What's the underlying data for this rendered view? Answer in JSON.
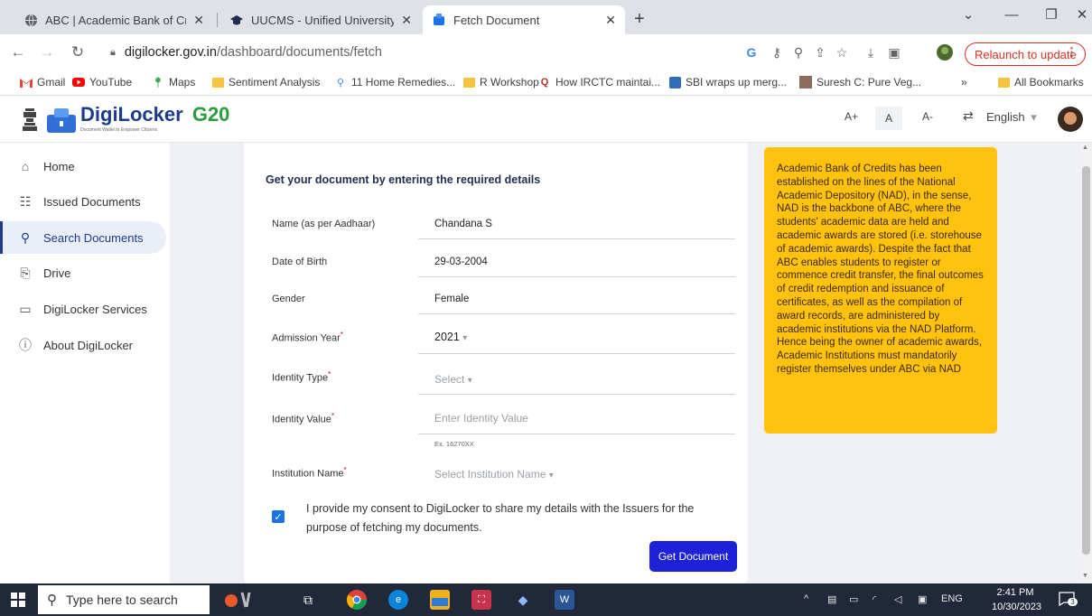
{
  "browser": {
    "tabs": [
      {
        "title": "ABC | Academic Bank of Credits",
        "active": false
      },
      {
        "title": "UUCMS - Unified University Coll",
        "active": false
      },
      {
        "title": "Fetch Document",
        "active": true
      }
    ],
    "new_tab": "+",
    "url_host": "digilocker.gov.in",
    "url_path": "/dashboard/documents/fetch",
    "relaunch_label": "Relaunch to update",
    "bookmarks": [
      {
        "label": "Gmail",
        "icon": "gmail-icon"
      },
      {
        "label": "YouTube",
        "icon": "youtube-icon"
      },
      {
        "label": "Maps",
        "icon": "maps-icon"
      },
      {
        "label": "Sentiment Analysis",
        "icon": "folder-icon"
      },
      {
        "label": "11 Home Remedies...",
        "icon": "link-icon"
      },
      {
        "label": "R Workshop",
        "icon": "folder-icon"
      },
      {
        "label": "How IRCTC maintai...",
        "icon": "quora-icon"
      },
      {
        "label": "SBI wraps up merg...",
        "icon": "page-icon"
      },
      {
        "label": "Suresh C: Pure Veg...",
        "icon": "image-icon"
      }
    ],
    "bookmarks_overflow": "»",
    "all_bookmarks": "All Bookmarks"
  },
  "header": {
    "logo_text": "DigiLocker",
    "logo_tagline": "Document Wallet to Empower Citizens",
    "g20": "G20",
    "font_increase": "A+",
    "font_normal": "A",
    "font_decrease": "A-",
    "language": "English"
  },
  "sidebar": {
    "items": [
      {
        "label": "Home",
        "icon": "home-icon",
        "active": false
      },
      {
        "label": "Issued Documents",
        "icon": "issued-documents-icon",
        "active": false
      },
      {
        "label": "Search Documents",
        "icon": "search-icon",
        "active": true
      },
      {
        "label": "Drive",
        "icon": "drive-icon",
        "active": false
      },
      {
        "label": "DigiLocker Services",
        "icon": "services-icon",
        "active": false
      },
      {
        "label": "About DigiLocker",
        "icon": "info-icon",
        "active": false
      }
    ]
  },
  "form": {
    "title": "Get your document by entering the required details",
    "fields": {
      "name": {
        "label": "Name (as per Aadhaar)",
        "value": "Chandana S"
      },
      "dob": {
        "label": "Date of Birth",
        "value": "29-03-2004"
      },
      "gender": {
        "label": "Gender",
        "value": "Female"
      },
      "admission_year": {
        "label": "Admission Year",
        "value": "2021",
        "required": "*"
      },
      "identity_type": {
        "label": "Identity Type",
        "placeholder": "Select",
        "required": "*"
      },
      "identity_value": {
        "label": "Identity Value",
        "placeholder": "Enter Identity Value",
        "hint": "Ex. 16270XX",
        "required": "*"
      },
      "institution": {
        "label": "Institution Name",
        "placeholder": "Select Institution Name",
        "required": "*"
      }
    },
    "consent": "I provide my consent to DigiLocker to share my details with the Issuers for the purpose of fetching my documents.",
    "consent_checked": true,
    "submit_label": "Get Document"
  },
  "info": {
    "text": "Academic Bank of Credits has been established on the lines of the National Academic Depository (NAD), in the sense, NAD is the backbone of ABC, where the students' academic data are held and academic awards are stored (i.e. storehouse of academic awards). Despite the fact that ABC enables students to register or commence credit transfer, the final outcomes of credit redemption and issuance of certificates, as well as the compilation of award records, are administered by academic institutions via the NAD Platform. Hence being the owner of academic awards, Academic Institutions must mandatorily register themselves under ABC via NAD"
  },
  "taskbar": {
    "search_placeholder": "Type here to search",
    "language": "ENG",
    "time": "2:41 PM",
    "date": "10/30/2023",
    "notifications": "3"
  },
  "colors": {
    "digilocker_blue": "#1d3b8b",
    "submit_blue": "#1e22d6",
    "info_yellow": "#ffc20e",
    "relaunch_red": "#d93025"
  }
}
